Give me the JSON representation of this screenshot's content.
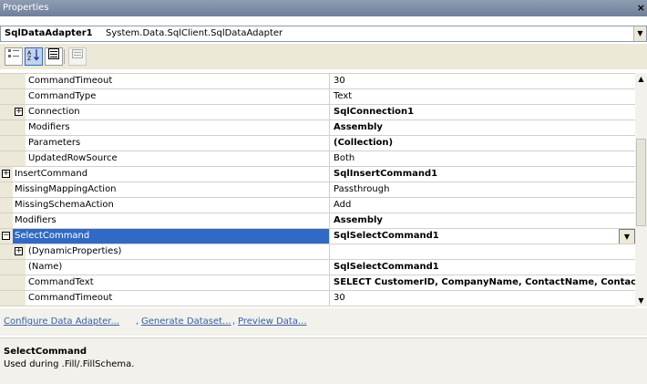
{
  "window": {
    "title": "Properties",
    "close_glyph": "×"
  },
  "object_selector": {
    "name": "SqlDataAdapter1",
    "type": "System.Data.SqlClient.SqlDataAdapter",
    "dropdown_glyph": "▼"
  },
  "toolbar": {
    "categorized_icon": "categorized-icon",
    "alphabetical_icon": "alphabetical-icon",
    "properties_icon": "properties-icon",
    "property_pages_icon": "property-pages-icon"
  },
  "grid": {
    "rows": [
      {
        "name": "CommandTimeout",
        "value": "30",
        "bold": false,
        "indent": 2,
        "expander": ""
      },
      {
        "name": "CommandType",
        "value": "Text",
        "bold": false,
        "indent": 2,
        "expander": ""
      },
      {
        "name": "Connection",
        "value": "SqlConnection1",
        "bold": true,
        "indent": 2,
        "expander": "+"
      },
      {
        "name": "Modifiers",
        "value": "Assembly",
        "bold": true,
        "indent": 2,
        "expander": ""
      },
      {
        "name": "Parameters",
        "value": "(Collection)",
        "bold": true,
        "indent": 2,
        "expander": ""
      },
      {
        "name": "UpdatedRowSource",
        "value": "Both",
        "bold": false,
        "indent": 2,
        "expander": ""
      },
      {
        "name": "InsertCommand",
        "value": "SqlInsertCommand1",
        "bold": true,
        "indent": 1,
        "expander": "+"
      },
      {
        "name": "MissingMappingAction",
        "value": "Passthrough",
        "bold": false,
        "indent": 1,
        "expander": ""
      },
      {
        "name": "MissingSchemaAction",
        "value": "Add",
        "bold": false,
        "indent": 1,
        "expander": ""
      },
      {
        "name": "Modifiers",
        "value": "Assembly",
        "bold": true,
        "indent": 1,
        "expander": ""
      },
      {
        "name": "SelectCommand",
        "value": "SqlSelectCommand1",
        "bold": true,
        "indent": 1,
        "expander": "−",
        "selected": true
      },
      {
        "name": "(DynamicProperties)",
        "value": "",
        "bold": false,
        "indent": 2,
        "expander": "+"
      },
      {
        "name": "(Name)",
        "value": "SqlSelectCommand1",
        "bold": true,
        "indent": 2,
        "expander": ""
      },
      {
        "name": "CommandText",
        "value": "SELECT CustomerID, CompanyName, ContactName, ContactT",
        "bold": true,
        "indent": 2,
        "expander": ""
      },
      {
        "name": "CommandTimeout",
        "value": "30",
        "bold": false,
        "indent": 2,
        "expander": ""
      }
    ]
  },
  "commands": {
    "links": [
      "Configure Data Adapter...",
      "Generate Dataset...",
      "Preview Data..."
    ],
    "separator": ","
  },
  "description": {
    "title": "SelectCommand",
    "text": "Used during .Fill/.FillSchema."
  }
}
